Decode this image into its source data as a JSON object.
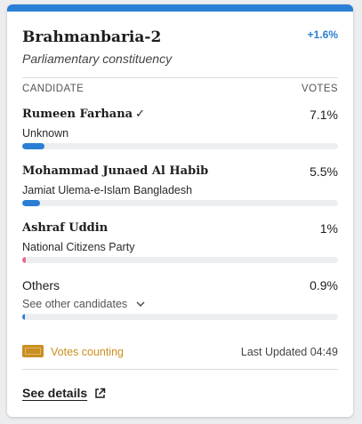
{
  "colors": {
    "accent": "#2a7fd4",
    "swing": "#2a7fd4",
    "bar_blue": "#2a7fd4",
    "bar_pink": "#e36d8f",
    "status": "#c98f1f",
    "track": "#edeef0"
  },
  "constituency": {
    "name": "Brahmanbaria-2",
    "type": "Parliamentary constituency",
    "swing": "+1.6%"
  },
  "columns": {
    "candidate": "CANDIDATE",
    "votes": "VOTES"
  },
  "candidates": [
    {
      "name": "Rumeen Farhana",
      "winner_mark": "✓",
      "party": "Unknown",
      "votes": "7.1%",
      "share": 7.1,
      "color": "#2a7fd4"
    },
    {
      "name": "Mohammad Junaed Al Habib",
      "party": "Jamiat Ulema-e-Islam Bangladesh",
      "votes": "5.5%",
      "share": 5.5,
      "color": "#2a7fd4"
    },
    {
      "name": "Ashraf Uddin",
      "party": "National Citizens Party",
      "votes": "1%",
      "share": 1.0,
      "color": "#e36d8f"
    }
  ],
  "others": {
    "label": "Others",
    "toggle_label": "See other candidates",
    "votes": "0.9%",
    "share": 0.9,
    "color": "#2a7fd4"
  },
  "status": {
    "label": "Votes counting",
    "icon": "status-square-icon",
    "updated": "Last Updated 04:49"
  },
  "details_link": {
    "label": "See details",
    "icon": "external-link-icon"
  }
}
